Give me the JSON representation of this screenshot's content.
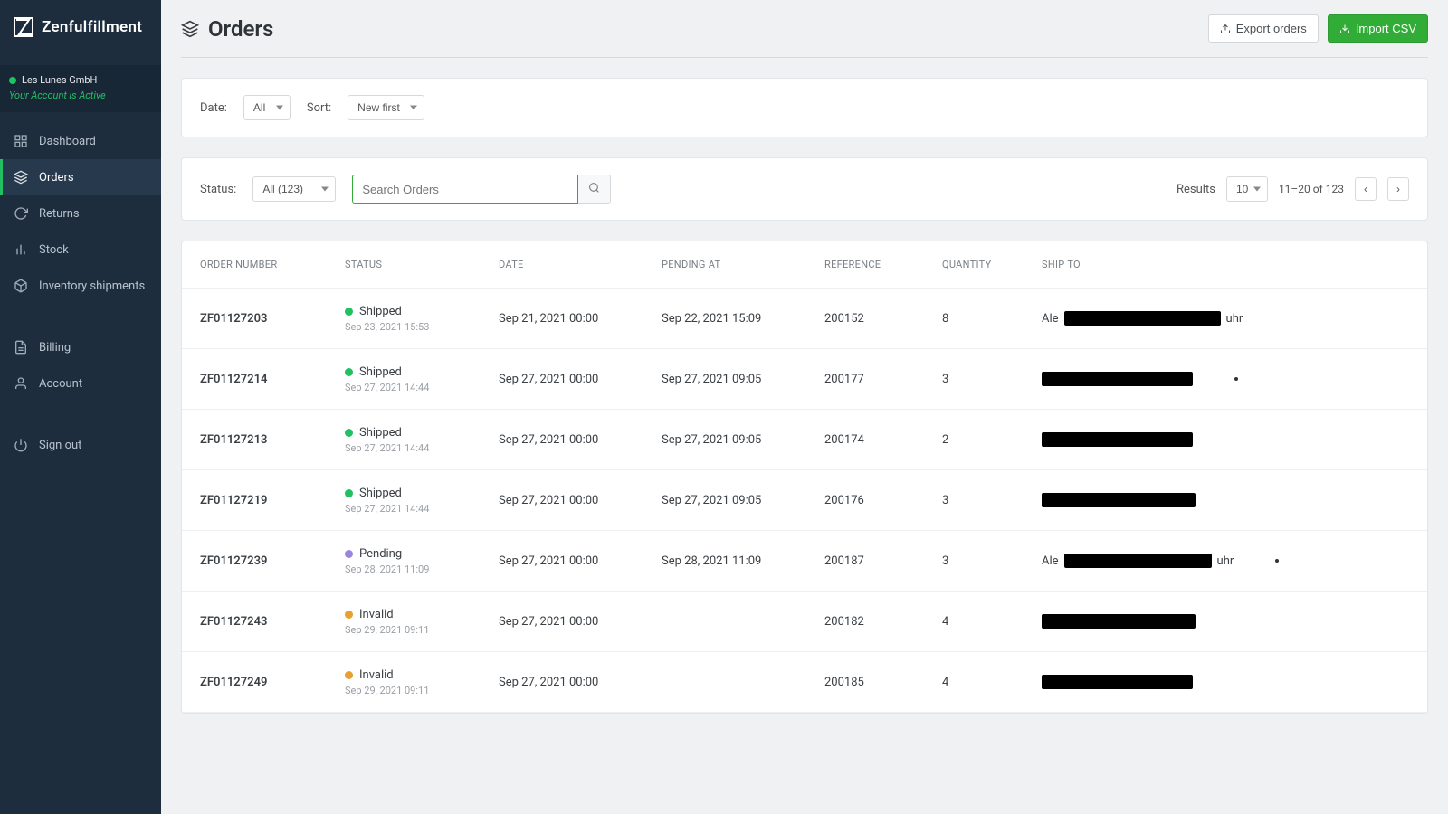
{
  "brand": {
    "name": "Zenfulfillment"
  },
  "account": {
    "company": "Les Lunes GmbH",
    "status_text": "Your Account is Active"
  },
  "nav": {
    "dashboard": "Dashboard",
    "orders": "Orders",
    "returns": "Returns",
    "stock": "Stock",
    "inventory": "Inventory shipments",
    "billing": "Billing",
    "account": "Account",
    "signout": "Sign out",
    "active": "orders"
  },
  "page": {
    "title": "Orders"
  },
  "actions": {
    "export": "Export orders",
    "import": "Import CSV"
  },
  "filters": {
    "date_label": "Date:",
    "date_value": "All",
    "sort_label": "Sort:",
    "sort_value": "New first",
    "status_label": "Status:",
    "status_value": "All (123)",
    "search_placeholder": "Search Orders",
    "results_label": "Results",
    "results_per_page": "10",
    "page_range": "11–20 of 123"
  },
  "columns": {
    "order_number": "ORDER NUMBER",
    "status": "STATUS",
    "date": "DATE",
    "pending_at": "PENDING AT",
    "reference": "REFERENCE",
    "quantity": "QUANTITY",
    "ship_to": "SHIP TO"
  },
  "status_colors": {
    "Shipped": "#21c162",
    "Pending": "#9b84e0",
    "Invalid": "#e8a030"
  },
  "rows": [
    {
      "order": "ZF01127203",
      "status": "Shipped",
      "status_ts": "Sep 23, 2021 15:53",
      "date": "Sep 21, 2021 00:00",
      "pending": "Sep 22, 2021 15:09",
      "ref": "200152",
      "qty": "8",
      "ship_prefix": "Ale",
      "ship_suffix": "uhr",
      "redact_w": 173,
      "dot": false
    },
    {
      "order": "ZF01127214",
      "status": "Shipped",
      "status_ts": "Sep 27, 2021 14:44",
      "date": "Sep 27, 2021 00:00",
      "pending": "Sep 27, 2021 09:05",
      "ref": "200177",
      "qty": "3",
      "ship_prefix": "",
      "ship_suffix": "",
      "redact_w": 167,
      "dot": true
    },
    {
      "order": "ZF01127213",
      "status": "Shipped",
      "status_ts": "Sep 27, 2021 14:44",
      "date": "Sep 27, 2021 00:00",
      "pending": "Sep 27, 2021 09:05",
      "ref": "200174",
      "qty": "2",
      "ship_prefix": "",
      "ship_suffix": "",
      "redact_w": 167,
      "dot": false
    },
    {
      "order": "ZF01127219",
      "status": "Shipped",
      "status_ts": "Sep 27, 2021 14:44",
      "date": "Sep 27, 2021 00:00",
      "pending": "Sep 27, 2021 09:05",
      "ref": "200176",
      "qty": "3",
      "ship_prefix": "",
      "ship_suffix": "",
      "redact_w": 170,
      "dot": false
    },
    {
      "order": "ZF01127239",
      "status": "Pending",
      "status_ts": "Sep 28, 2021 11:09",
      "date": "Sep 27, 2021 00:00",
      "pending": "Sep 28, 2021 11:09",
      "ref": "200187",
      "qty": "3",
      "ship_prefix": "Ale",
      "ship_suffix": "uhr",
      "redact_w": 163,
      "dot": true
    },
    {
      "order": "ZF01127243",
      "status": "Invalid",
      "status_ts": "Sep 29, 2021 09:11",
      "date": "Sep 27, 2021 00:00",
      "pending": "",
      "ref": "200182",
      "qty": "4",
      "ship_prefix": "",
      "ship_suffix": "",
      "redact_w": 170,
      "dot": false
    },
    {
      "order": "ZF01127249",
      "status": "Invalid",
      "status_ts": "Sep 29, 2021 09:11",
      "date": "Sep 27, 2021 00:00",
      "pending": "",
      "ref": "200185",
      "qty": "4",
      "ship_prefix": "",
      "ship_suffix": "",
      "redact_w": 167,
      "dot": false
    }
  ]
}
